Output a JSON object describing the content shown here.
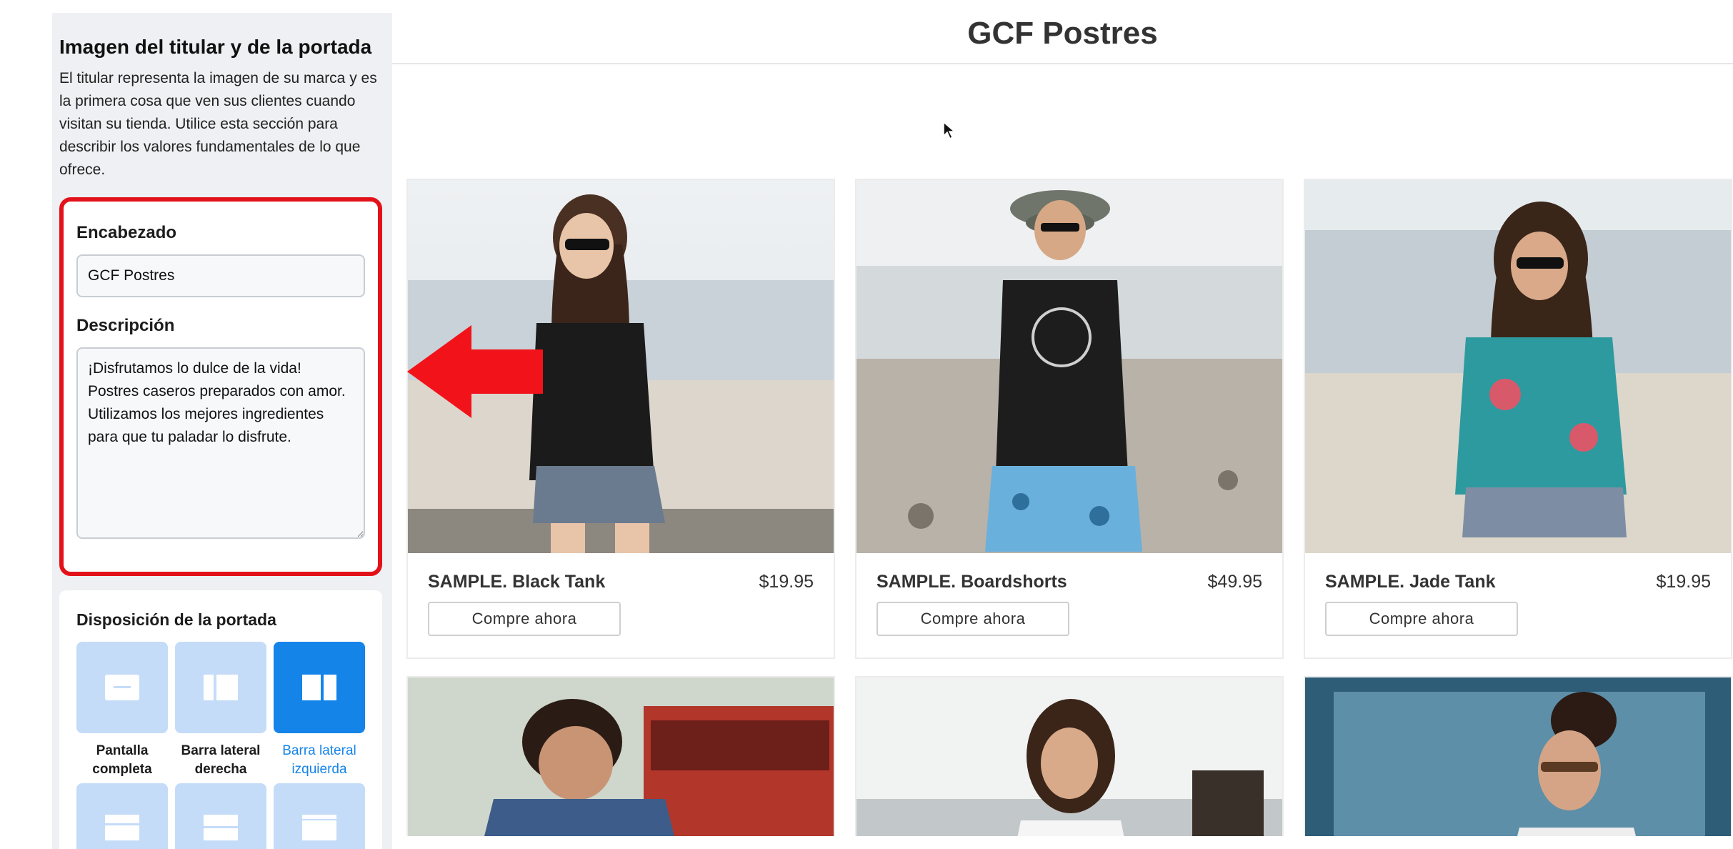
{
  "editor": {
    "section_title": "Imagen del titular y de la portada",
    "section_description": "El titular representa la imagen de su marca y es la primera cosa que ven sus clientes cuando visitan su tienda. Utilice esta sección para describir los valores fundamentales de lo que ofrece.",
    "heading_label": "Encabezado",
    "heading_value": "GCF Postres",
    "description_label": "Descripción",
    "description_value": "¡Disfrutamos lo dulce de la vida! Postres caseros preparados con amor.\nUtilizamos los mejores ingredientes para que tu paladar lo disfrute.",
    "layout_title": "Disposición de la portada",
    "layouts": [
      {
        "label": "Pantalla completa",
        "icon": "full-screen-layout-icon"
      },
      {
        "label": "Barra lateral derecha",
        "icon": "right-sidebar-layout-icon"
      },
      {
        "label": "Barra lateral izquierda",
        "icon": "left-sidebar-layout-icon",
        "selected": true
      },
      {
        "label": "",
        "icon": "banner-top-layout-icon"
      },
      {
        "label": "",
        "icon": "banner-middle-layout-icon"
      },
      {
        "label": "",
        "icon": "banner-bottom-layout-icon"
      }
    ],
    "highlight_color": "#e3121a",
    "accent_color": "#1584e8"
  },
  "store": {
    "title": "GCF Postres",
    "products": [
      {
        "name": "SAMPLE. Black Tank",
        "price": "$19.95",
        "button": "Compre ahora"
      },
      {
        "name": "SAMPLE. Boardshorts",
        "price": "$49.95",
        "button": "Compre ahora"
      },
      {
        "name": "SAMPLE. Jade Tank",
        "price": "$19.95",
        "button": "Compre ahora"
      }
    ]
  }
}
